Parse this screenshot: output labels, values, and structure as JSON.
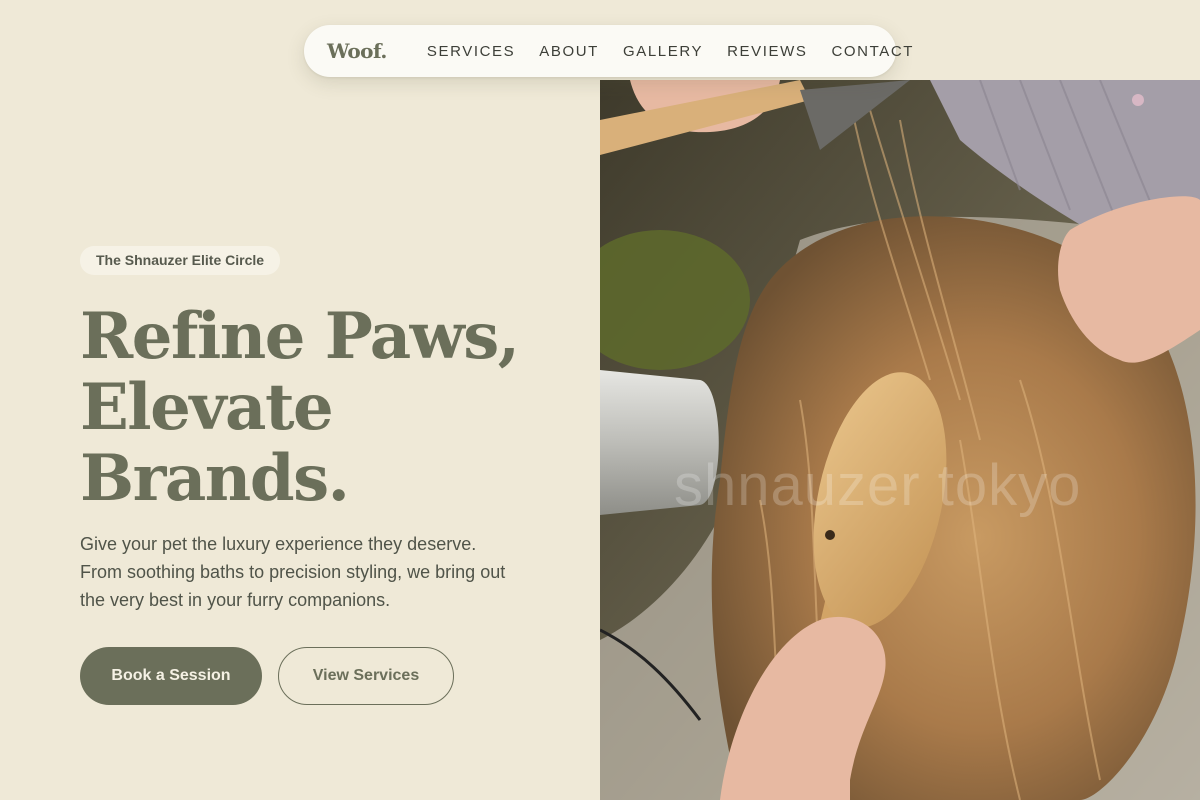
{
  "nav": {
    "logo": "Woof.",
    "links": [
      "SERVICES",
      "ABOUT",
      "GALLERY",
      "REVIEWS",
      "CONTACT"
    ]
  },
  "hero": {
    "badge": "The Shnauzer Elite Circle",
    "headline": [
      "Refine Paws,",
      "Elevate",
      "Brands."
    ],
    "subtext": "Give your pet the luxury experience they deserve. From soothing baths to precision styling, we bring out the very best in your furry companions.",
    "primary_cta": "Book a Session",
    "secondary_cta": "View Services"
  },
  "image": {
    "watermark": "shnauzer tokyo"
  },
  "colors": {
    "background": "#efe9d7",
    "accent": "#6b6f5a",
    "nav_bg": "#fbfaf5"
  }
}
